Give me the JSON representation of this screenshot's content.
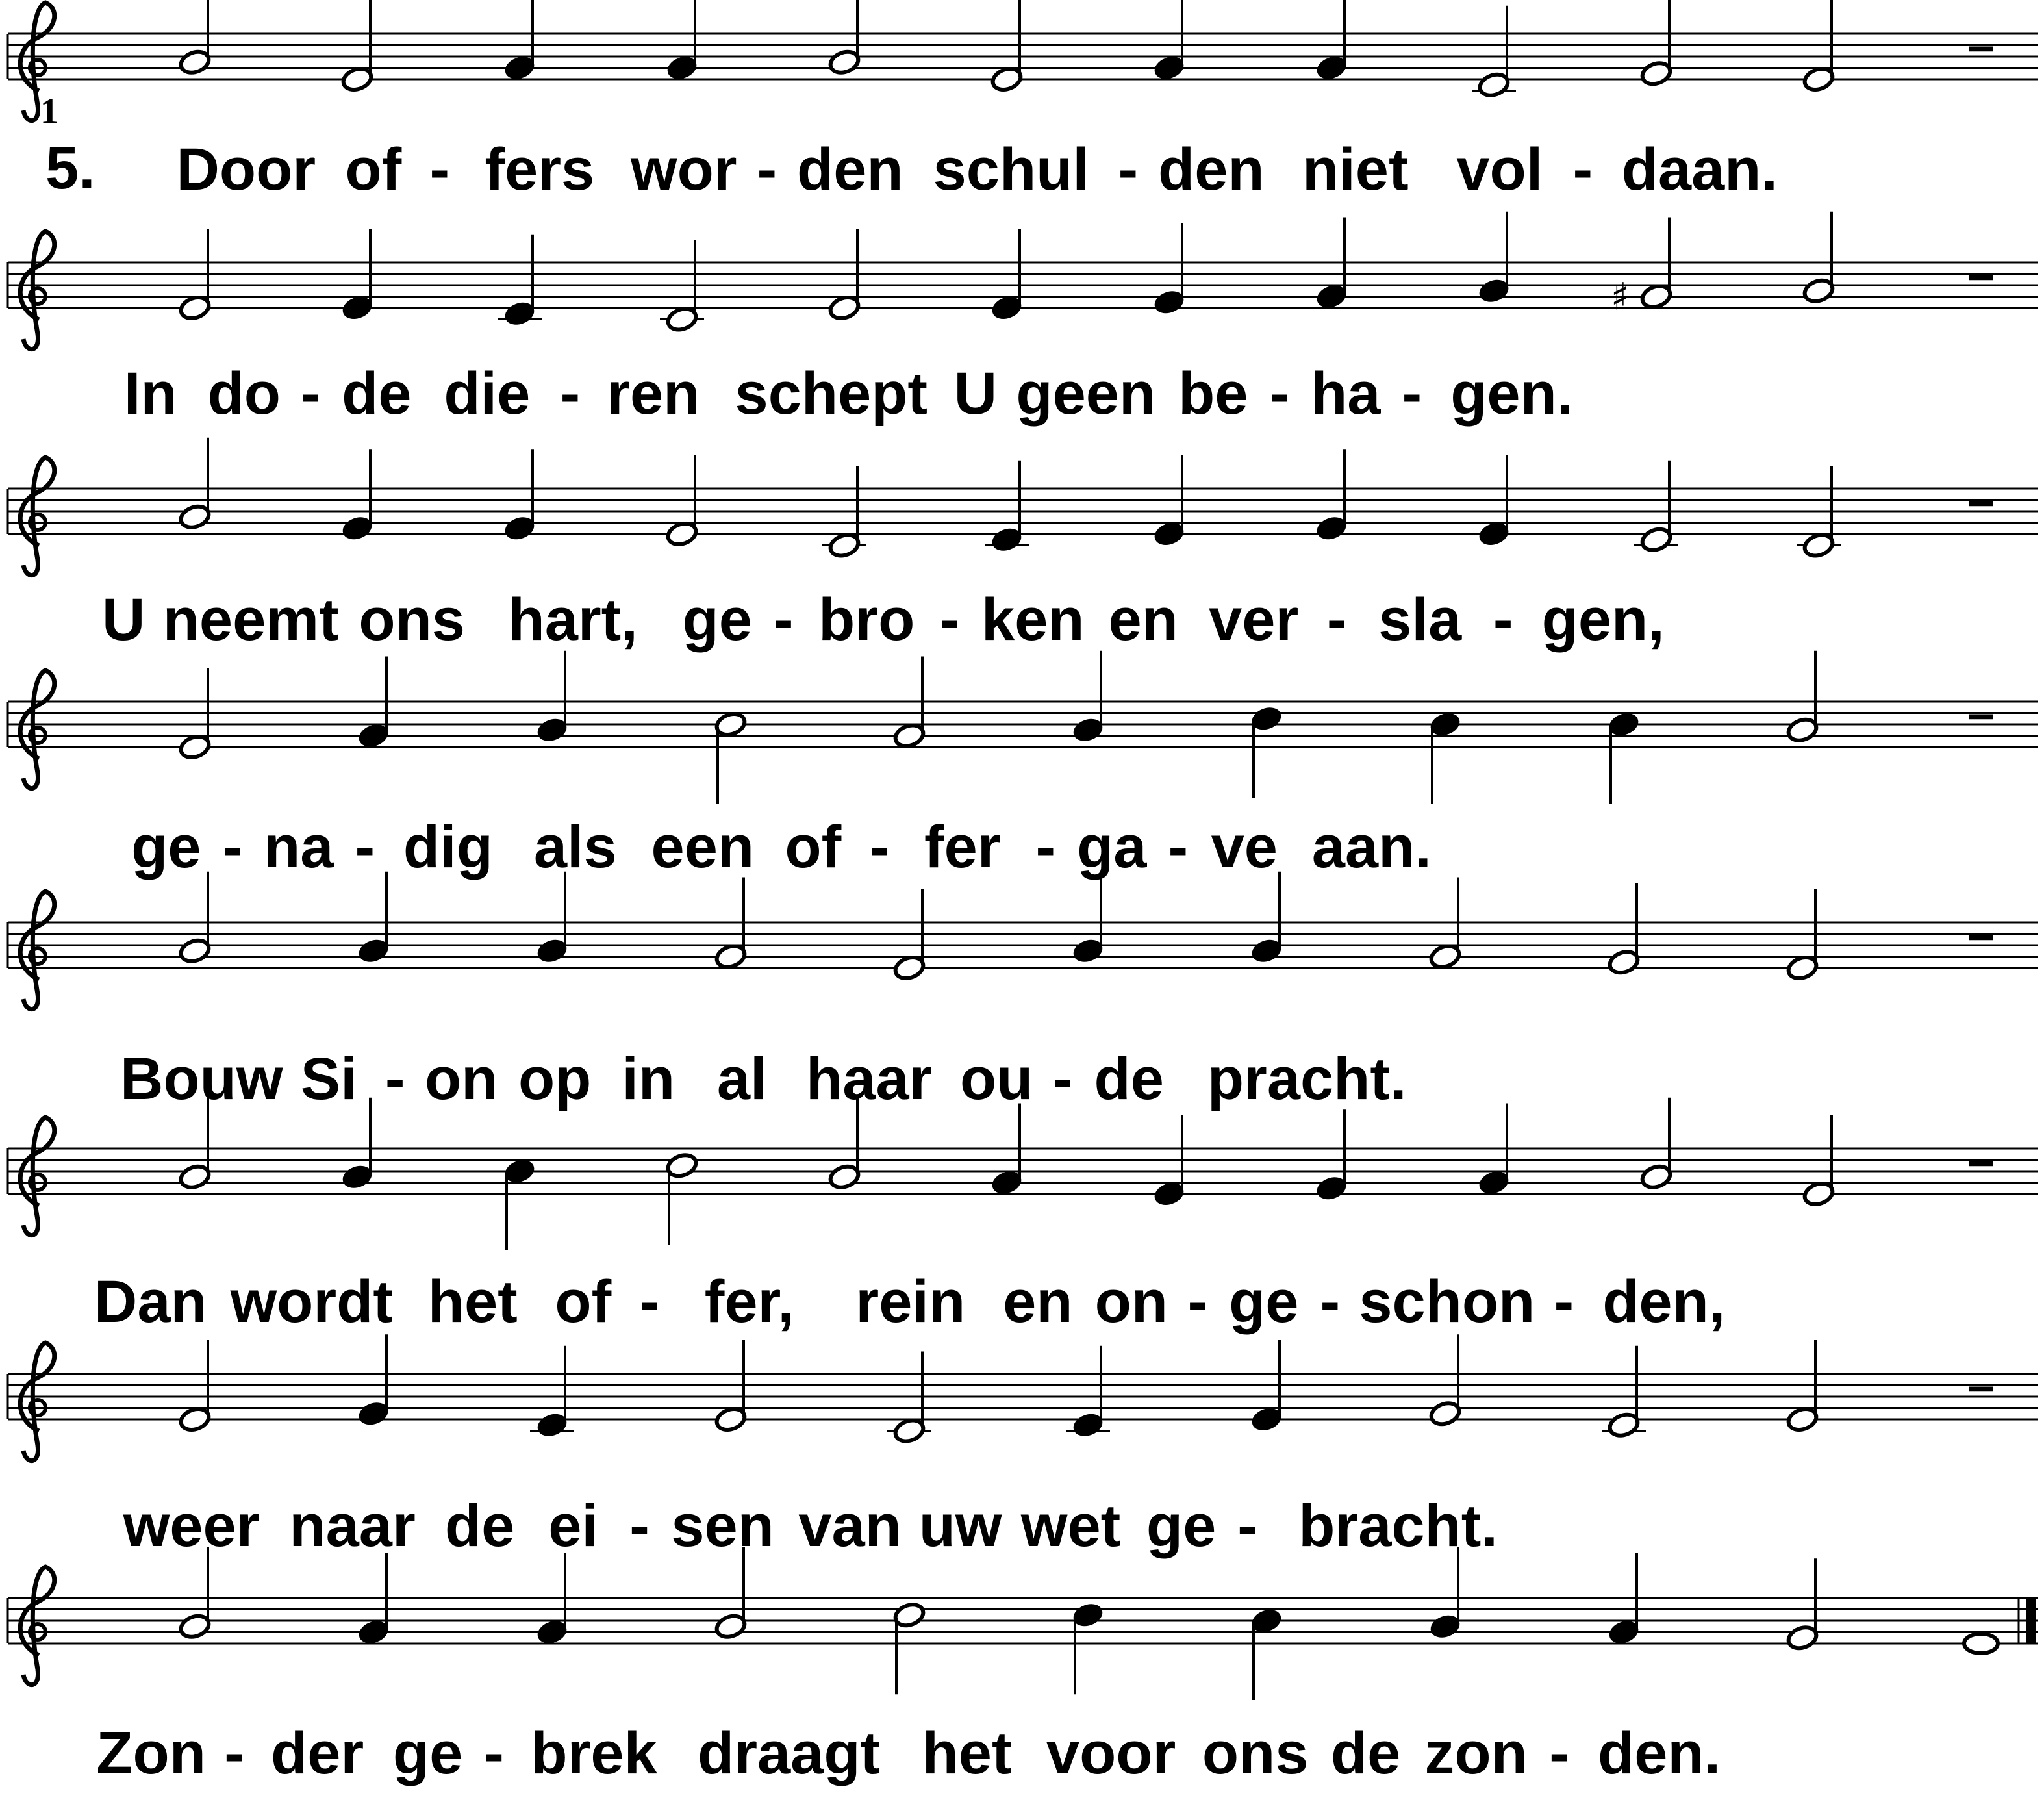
{
  "stanza_number": "5.",
  "bar_number": "1",
  "systems": [
    {
      "notes": [
        {
          "p": "A4",
          "d": "h"
        },
        {
          "p": "E4",
          "d": "h"
        },
        {
          "p": "G4",
          "d": "q"
        },
        {
          "p": "G4",
          "d": "q"
        },
        {
          "p": "A4",
          "d": "h"
        },
        {
          "p": "E4",
          "d": "h"
        },
        {
          "p": "G4",
          "d": "q"
        },
        {
          "p": "G4",
          "d": "q"
        },
        {
          "p": "D4",
          "d": "h"
        },
        {
          "p": "F4",
          "d": "h"
        },
        {
          "p": "E4",
          "d": "h"
        },
        {
          "rest": "h"
        }
      ],
      "lyrics": [
        "Door",
        "of",
        "-",
        "fers",
        "wor",
        "-",
        "den",
        "schul",
        "-",
        "den",
        "niet",
        "vol",
        "-",
        "daan."
      ]
    },
    {
      "notes": [
        {
          "p": "E4",
          "d": "h"
        },
        {
          "p": "E4",
          "d": "q"
        },
        {
          "p": "D4",
          "d": "q"
        },
        {
          "p": "C4",
          "d": "h"
        },
        {
          "p": "E4",
          "d": "h"
        },
        {
          "p": "E4",
          "d": "q"
        },
        {
          "p": "F4",
          "d": "q"
        },
        {
          "p": "G4",
          "d": "q"
        },
        {
          "p": "A4",
          "d": "q"
        },
        {
          "p": "G4",
          "d": "h",
          "acc": "♯"
        },
        {
          "p": "A4",
          "d": "h"
        },
        {
          "rest": "h"
        }
      ],
      "lyrics": [
        "In",
        "do",
        "-",
        "de",
        "die",
        "-",
        "ren",
        "schept",
        "U",
        "geen",
        "be",
        "-",
        "ha",
        "-",
        "gen."
      ]
    },
    {
      "notes": [
        {
          "p": "A4",
          "d": "h"
        },
        {
          "p": "F4",
          "d": "q"
        },
        {
          "p": "F4",
          "d": "q"
        },
        {
          "p": "E4",
          "d": "h"
        },
        {
          "p": "C4",
          "d": "h"
        },
        {
          "p": "D4",
          "d": "q"
        },
        {
          "p": "E4",
          "d": "q"
        },
        {
          "p": "F4",
          "d": "q"
        },
        {
          "p": "E4",
          "d": "q"
        },
        {
          "p": "D4",
          "d": "h"
        },
        {
          "p": "C4",
          "d": "h"
        },
        {
          "rest": "h"
        }
      ],
      "lyrics": [
        "U",
        "neemt",
        "ons",
        "hart,",
        "ge",
        "-",
        "bro",
        "-",
        "ken",
        "en",
        "ver",
        "-",
        "sla",
        "-",
        "gen,"
      ]
    },
    {
      "notes": [
        {
          "p": "E4",
          "d": "h"
        },
        {
          "p": "G4",
          "d": "q"
        },
        {
          "p": "A4",
          "d": "q"
        },
        {
          "p": "B4",
          "d": "h"
        },
        {
          "p": "G4",
          "d": "h"
        },
        {
          "p": "A4",
          "d": "q"
        },
        {
          "p": "C5",
          "d": "q"
        },
        {
          "p": "B4",
          "d": "q"
        },
        {
          "p": "B4",
          "d": "q"
        },
        {
          "p": "A4",
          "d": "h"
        },
        {
          "rest": "h"
        }
      ],
      "lyrics": [
        "ge",
        "-",
        "na",
        "-",
        "dig",
        "als",
        "een",
        "of",
        "-",
        "fer",
        "-",
        "ga",
        "-",
        "ve",
        "aan."
      ]
    },
    {
      "notes": [
        {
          "p": "A4",
          "d": "h"
        },
        {
          "p": "A4",
          "d": "q"
        },
        {
          "p": "A4",
          "d": "q"
        },
        {
          "p": "G4",
          "d": "h"
        },
        {
          "p": "E4",
          "d": "h"
        },
        {
          "p": "A4",
          "d": "q"
        },
        {
          "p": "A4",
          "d": "q"
        },
        {
          "p": "G4",
          "d": "h"
        },
        {
          "p": "F4",
          "d": "h"
        },
        {
          "p": "E4",
          "d": "h"
        },
        {
          "rest": "h"
        }
      ],
      "lyrics": [
        "Bouw",
        "Si",
        "-",
        "on",
        "op",
        "in",
        "al",
        "haar",
        "ou",
        "-",
        "de",
        "pracht."
      ]
    },
    {
      "notes": [
        {
          "p": "A4",
          "d": "h"
        },
        {
          "p": "A4",
          "d": "q"
        },
        {
          "p": "B4",
          "d": "q"
        },
        {
          "p": "C5",
          "d": "h"
        },
        {
          "p": "A4",
          "d": "h"
        },
        {
          "p": "G4",
          "d": "q"
        },
        {
          "p": "E4",
          "d": "q"
        },
        {
          "p": "F4",
          "d": "q"
        },
        {
          "p": "G4",
          "d": "q"
        },
        {
          "p": "A4",
          "d": "h"
        },
        {
          "p": "E4",
          "d": "h"
        },
        {
          "rest": "h"
        }
      ],
      "lyrics": [
        "Dan",
        "wordt",
        "het",
        "of",
        "-",
        "fer,",
        "rein",
        "en",
        "on",
        "-",
        "ge",
        "-",
        "schon",
        "-",
        "den,"
      ]
    },
    {
      "notes": [
        {
          "p": "E4",
          "d": "h"
        },
        {
          "p": "F4",
          "d": "q"
        },
        {
          "p": "D4",
          "d": "q"
        },
        {
          "p": "E4",
          "d": "h"
        },
        {
          "p": "C4",
          "d": "h"
        },
        {
          "p": "D4",
          "d": "q"
        },
        {
          "p": "E4",
          "d": "q"
        },
        {
          "p": "F4",
          "d": "h"
        },
        {
          "p": "D4",
          "d": "h"
        },
        {
          "p": "E4",
          "d": "h"
        },
        {
          "rest": "h"
        }
      ],
      "lyrics": [
        "weer",
        "naar",
        "de",
        "ei",
        "-",
        "sen",
        "van",
        "uw",
        "wet",
        "ge",
        "-",
        "bracht."
      ]
    },
    {
      "notes": [
        {
          "p": "A4",
          "d": "h"
        },
        {
          "p": "G4",
          "d": "q"
        },
        {
          "p": "G4",
          "d": "q"
        },
        {
          "p": "A4",
          "d": "h"
        },
        {
          "p": "C5",
          "d": "h"
        },
        {
          "p": "C5",
          "d": "q"
        },
        {
          "p": "B4",
          "d": "q"
        },
        {
          "p": "A4",
          "d": "q"
        },
        {
          "p": "G4",
          "d": "q"
        },
        {
          "p": "F4",
          "d": "h"
        },
        {
          "p": "E4",
          "d": "w"
        }
      ],
      "lyrics": [
        "Zon",
        "-",
        "der",
        "ge",
        "-",
        "brek",
        "draagt",
        "het",
        "voor",
        "ons",
        "de",
        "zon",
        "-",
        "den."
      ],
      "final_barline": true
    }
  ]
}
